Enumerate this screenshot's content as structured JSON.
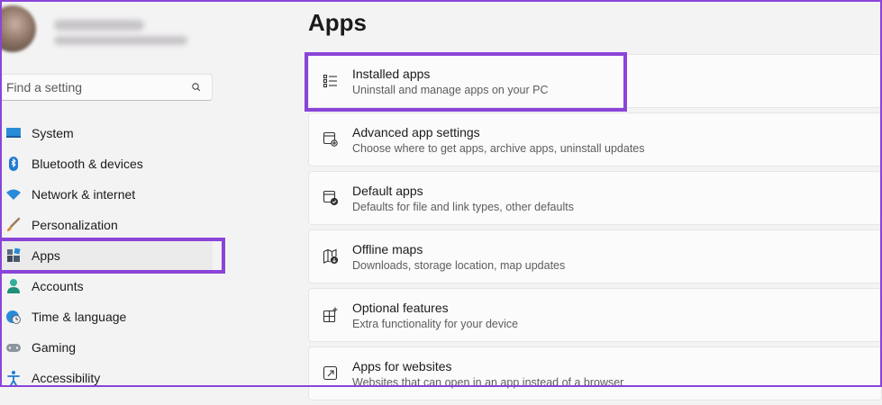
{
  "search": {
    "placeholder": "Find a setting"
  },
  "sidebar": {
    "items": [
      {
        "label": "System",
        "icon": "monitor-icon"
      },
      {
        "label": "Bluetooth & devices",
        "icon": "bluetooth-icon"
      },
      {
        "label": "Network & internet",
        "icon": "wifi-icon"
      },
      {
        "label": "Personalization",
        "icon": "brush-icon"
      },
      {
        "label": "Apps",
        "icon": "apps-icon",
        "selected": true
      },
      {
        "label": "Accounts",
        "icon": "person-icon"
      },
      {
        "label": "Time & language",
        "icon": "globe-clock-icon"
      },
      {
        "label": "Gaming",
        "icon": "gamepad-icon"
      },
      {
        "label": "Accessibility",
        "icon": "accessibility-icon"
      }
    ]
  },
  "main": {
    "title": "Apps",
    "cards": [
      {
        "title": "Installed apps",
        "subtitle": "Uninstall and manage apps on your PC",
        "icon": "list-icon"
      },
      {
        "title": "Advanced app settings",
        "subtitle": "Choose where to get apps, archive apps, uninstall updates",
        "icon": "app-gear-icon"
      },
      {
        "title": "Default apps",
        "subtitle": "Defaults for file and link types, other defaults",
        "icon": "default-apps-icon"
      },
      {
        "title": "Offline maps",
        "subtitle": "Downloads, storage location, map updates",
        "icon": "map-download-icon"
      },
      {
        "title": "Optional features",
        "subtitle": "Extra functionality for your device",
        "icon": "grid-plus-icon"
      },
      {
        "title": "Apps for websites",
        "subtitle": "Websites that can open in an app instead of a browser",
        "icon": "open-link-icon"
      }
    ]
  },
  "colors": {
    "highlight": "#8a44d8",
    "accent": "#0067c0"
  }
}
